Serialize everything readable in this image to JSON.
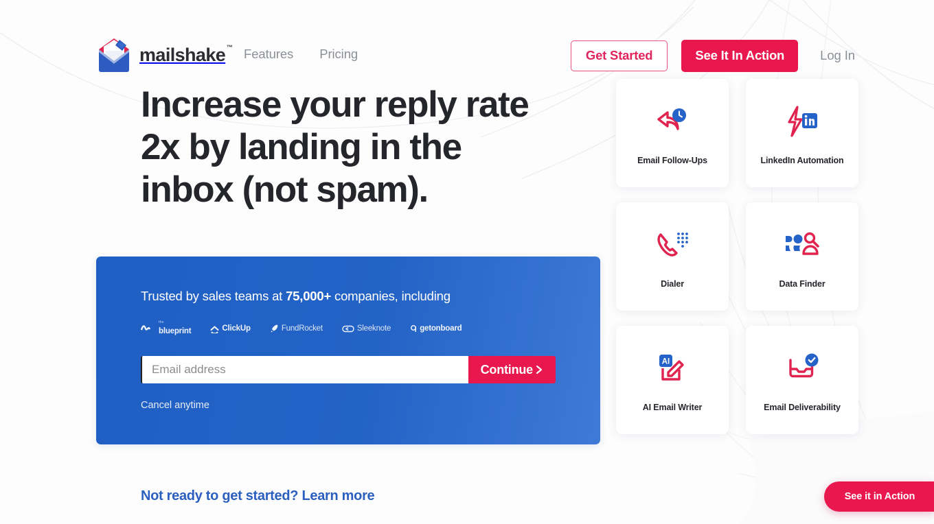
{
  "brand": {
    "name": "mailshake",
    "trademark": "™",
    "logo_icon": "envelope-logo-icon"
  },
  "colors": {
    "accent_pink": "#e8184f",
    "accent_pink_outline": "#e0245e",
    "brand_blue": "#2463c6",
    "link_blue": "#2a5fc0",
    "heading_dark": "#24262b",
    "nav_gray": "#8b9097"
  },
  "nav": {
    "links": [
      {
        "label": "Features"
      },
      {
        "label": "Pricing"
      }
    ]
  },
  "header": {
    "get_started_label": "Get Started",
    "see_in_action_label": "See It In Action",
    "login_label": "Log In"
  },
  "hero": {
    "heading": "Increase your reply rate 2x by landing in the inbox (not spam)."
  },
  "signup_card": {
    "trusted_prefix": "Trusted by sales teams at ",
    "trusted_count": "75,000+",
    "trusted_suffix": " companies, including",
    "brands": [
      {
        "name": "blueprint",
        "sub": "the",
        "icon": "blueprint-logo-icon"
      },
      {
        "name": "ClickUp",
        "icon": "clickup-logo-icon"
      },
      {
        "name": "FundRocket",
        "icon": "fundrocket-logo-icon"
      },
      {
        "name": "Sleeknote",
        "icon": "sleeknote-logo-icon"
      },
      {
        "name": "getonboard",
        "icon": "getonboard-logo-icon"
      }
    ],
    "email_placeholder": "Email address",
    "email_value": "",
    "continue_label": "Continue",
    "continue_icon": "chevron-right-icon",
    "cancel_note": "Cancel anytime"
  },
  "learn_more": {
    "label": "Not ready to get started? Learn more"
  },
  "features": [
    {
      "label": "Email Follow-Ups",
      "icon": "reply-clock-icon"
    },
    {
      "label": "LinkedIn Automation",
      "icon": "linkedin-bolt-icon"
    },
    {
      "label": "Dialer",
      "icon": "phone-keypad-icon"
    },
    {
      "label": "Data Finder",
      "icon": "person-search-icon"
    },
    {
      "label": "AI Email Writer",
      "icon": "ai-pencil-icon"
    },
    {
      "label": "Email Deliverability",
      "icon": "inbox-check-icon"
    }
  ],
  "floating_cta": {
    "label": "See it in Action"
  }
}
